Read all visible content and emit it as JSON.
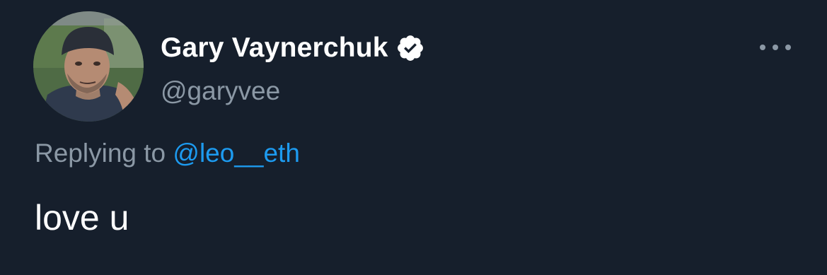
{
  "tweet": {
    "author": {
      "display_name": "Gary Vaynerchuk",
      "handle": "@garyvee",
      "verified": true
    },
    "reply": {
      "prefix": "Replying to",
      "mention": "@leo__eth"
    },
    "text": "love u"
  },
  "icons": {
    "verified": "verified-badge-icon",
    "more": "more-options-icon"
  },
  "colors": {
    "background": "#161f2c",
    "primary_text": "#ffffff",
    "secondary_text": "#8b98a5",
    "link": "#1d9bf0"
  }
}
